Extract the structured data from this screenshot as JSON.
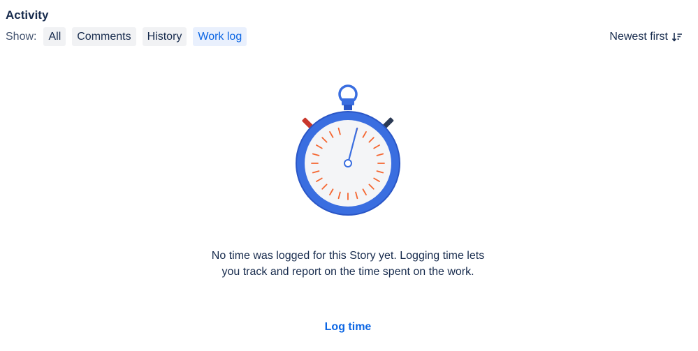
{
  "activity": {
    "title": "Activity",
    "show_label": "Show:",
    "filters": [
      {
        "label": "All",
        "selected": false
      },
      {
        "label": "Comments",
        "selected": false
      },
      {
        "label": "History",
        "selected": false
      },
      {
        "label": "Work log",
        "selected": true
      }
    ],
    "sort_label": "Newest first",
    "sort_icon": "sort-descending-icon"
  },
  "empty_state": {
    "illustration": "stopwatch-icon",
    "message": "No time was logged for this Story yet. Logging time lets you track and report on the time spent on the work.",
    "action_label": "Log time"
  },
  "colors": {
    "text": "#172b4d",
    "subtle_text": "#42526e",
    "link": "#0c66e4",
    "chip_bg": "#f1f2f4",
    "chip_selected_bg": "#e9f0fd",
    "stopwatch_blue": "#3a6ee0",
    "tick_orange": "#f5652f",
    "left_button_red": "#c9372c",
    "right_button_navy": "#2b3a55"
  }
}
